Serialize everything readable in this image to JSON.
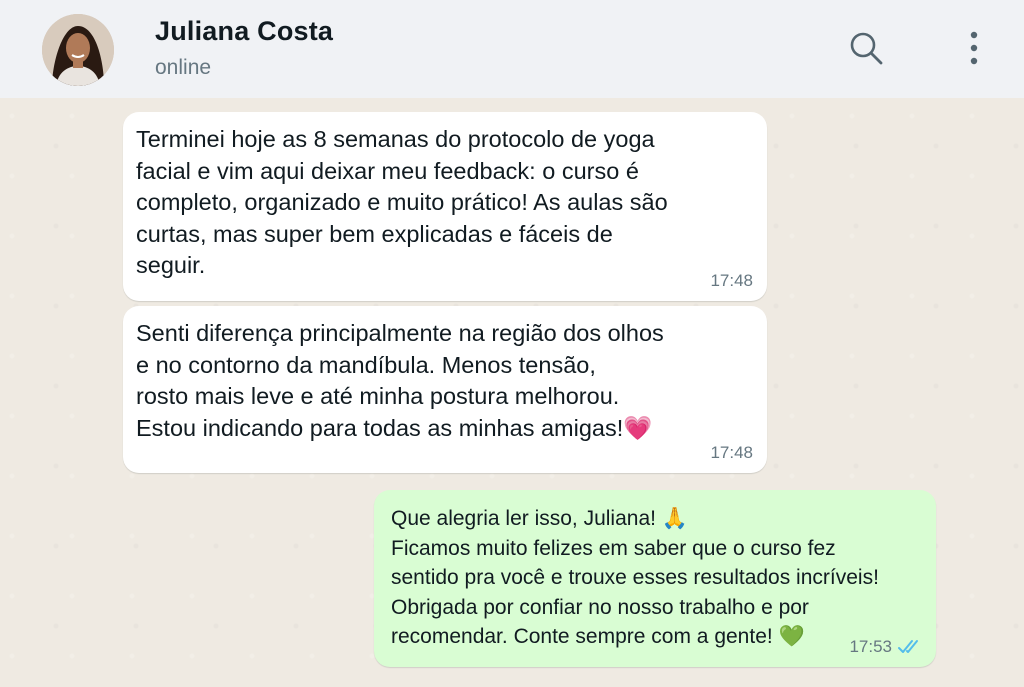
{
  "header": {
    "contact_name": "Juliana Costa",
    "status": "online",
    "icons": {
      "search": "search-icon",
      "menu": "more-vertical-icon"
    }
  },
  "messages": [
    {
      "direction": "incoming",
      "lines": [
        "Terminei hoje as 8 semanas do protocolo de yoga",
        "facial e vim aqui deixar meu feedback: o curso é",
        "completo, organizado e muito prático! As aulas são",
        "curtas, mas super bem explicadas e fáceis de",
        "seguir."
      ],
      "time": "17:48"
    },
    {
      "direction": "incoming",
      "lines": [
        "Senti diferença principalmente na região dos olhos",
        "e no contorno da mandíbula. Menos tensão,",
        "rosto mais leve e até minha postura melhorou.",
        "Estou indicando para todas as minhas amigas!"
      ],
      "emoji": "💗",
      "time": "17:48"
    },
    {
      "direction": "outgoing",
      "lines": [
        "Que alegria ler isso, Juliana!",
        "Ficamos muito felizes em saber que o curso fez",
        "sentido pra você e trouxe esses resultados incríveis!",
        "Obrigada por confiar no nosso trabalho e por",
        "recomendar. Conte sempre com a gente!"
      ],
      "emoji_line1": "🙏",
      "emoji_last": "💚",
      "time": "17:53",
      "status": "read"
    }
  ],
  "colors": {
    "incoming_bubble": "#ffffff",
    "outgoing_bubble": "#d9fdd3",
    "read_ticks": "#53bdeb",
    "chat_background": "#efeae2",
    "header_background": "#f0f2f5"
  }
}
